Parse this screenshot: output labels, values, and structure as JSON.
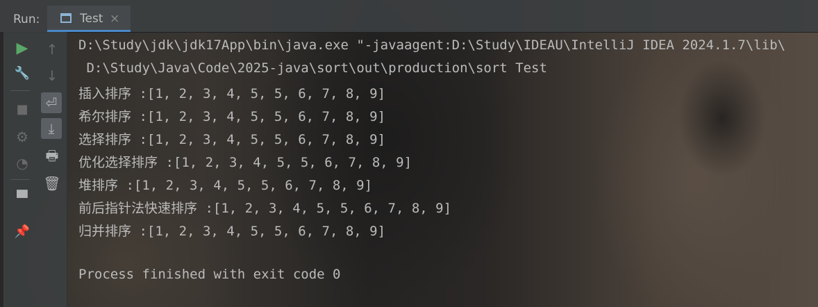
{
  "run_panel": {
    "label": "Run:",
    "tab": {
      "label": "Test",
      "close": "×"
    }
  },
  "toolbar_left": {
    "rerun": "▶",
    "settings": "🔧",
    "stop": "■",
    "debug": "⚙",
    "coverage": "◔",
    "layout": "▀",
    "pin": "📌"
  },
  "toolbar_right": {
    "up": "↑",
    "down": "↓",
    "soft_wrap": "⏎",
    "scroll_end": "⤓",
    "print": "🖶",
    "clear": "🗑"
  },
  "console": {
    "lines": [
      "D:\\Study\\jdk\\jdk17App\\bin\\java.exe \"-javaagent:D:\\Study\\IDEAU\\IntelliJ IDEA 2024.1.7\\lib\\",
      " D:\\Study\\Java\\Code\\2025-java\\sort\\out\\production\\sort Test",
      "插入排序 :[1, 2, 3, 4, 5, 5, 6, 7, 8, 9]",
      "希尔排序 :[1, 2, 3, 4, 5, 5, 6, 7, 8, 9]",
      "选择排序 :[1, 2, 3, 4, 5, 5, 6, 7, 8, 9]",
      "优化选择排序 :[1, 2, 3, 4, 5, 5, 6, 7, 8, 9]",
      "堆排序 :[1, 2, 3, 4, 5, 5, 6, 7, 8, 9]",
      "前后指针法快速排序 :[1, 2, 3, 4, 5, 5, 6, 7, 8, 9]",
      "归并排序 :[1, 2, 3, 4, 5, 5, 6, 7, 8, 9]",
      "",
      "Process finished with exit code 0"
    ]
  },
  "colors": {
    "accent": "#4a88c7",
    "run_green": "#59a869",
    "text": "#bbbbbb"
  }
}
